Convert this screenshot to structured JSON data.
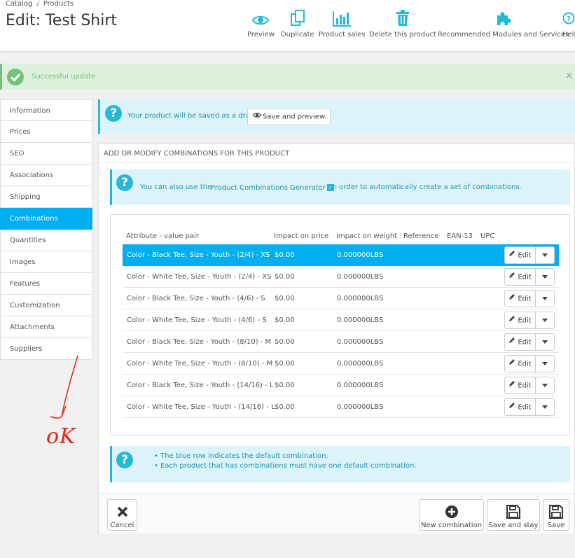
{
  "header": {
    "breadcrumb": [
      "Catalog",
      "Products"
    ],
    "breadcrumb_sep": "/",
    "title": "Edit: Test Shirt",
    "toolbar": {
      "preview": "Preview",
      "duplicate": "Duplicate",
      "product_sales": "Product sales",
      "delete": "Delete this product",
      "recommended": "Recommended Modules and Services",
      "help": "Help"
    }
  },
  "alert_success": {
    "message": "Successful update",
    "close": "×"
  },
  "tabs": [
    "Information",
    "Prices",
    "SEO",
    "Associations",
    "Shipping",
    "Combinations",
    "Quantities",
    "Images",
    "Features",
    "Customization",
    "Attachments",
    "Suppliers"
  ],
  "draft_notice": {
    "text": "Your product will be saved as a draft.",
    "button": "Save and preview"
  },
  "panel": {
    "heading": "ADD OR MODIFY COMBINATIONS FOR THIS PRODUCT",
    "generator_info": {
      "before": "You can also use the",
      "link": "Product Combinations Generator",
      "after": "in order to automatically create a set of combinations."
    },
    "table": {
      "headers": [
        "Attribute - value pair",
        "Impact on price",
        "Impact on weight",
        "Reference",
        "EAN-13",
        "UPC"
      ],
      "edit_label": "Edit",
      "rows": [
        {
          "attr": "Color - Black Tee, Size - Youth - (2/4) - XS",
          "price": "$0.00",
          "weight": "0.000000LBS",
          "default": true
        },
        {
          "attr": "Color - White Tee, Size - Youth - (2/4) - XS",
          "price": "$0.00",
          "weight": "0.000000LBS",
          "default": false
        },
        {
          "attr": "Color - Black Tee, Size - Youth - (4/6) - S",
          "price": "$0.00",
          "weight": "0.000000LBS",
          "default": false
        },
        {
          "attr": "Color - White Tee, Size - Youth - (4/6) - S",
          "price": "$0.00",
          "weight": "0.000000LBS",
          "default": false
        },
        {
          "attr": "Color - Black Tee, Size - Youth - (8/10) - M",
          "price": "$0.00",
          "weight": "0.000000LBS",
          "default": false
        },
        {
          "attr": "Color - White Tee, Size - Youth - (8/10) - M",
          "price": "$0.00",
          "weight": "0.000000LBS",
          "default": false
        },
        {
          "attr": "Color - Black Tee, Size - Youth - (14/16) - L",
          "price": "$0.00",
          "weight": "0.000000LBS",
          "default": false
        },
        {
          "attr": "Color - White Tee, Size - Youth - (14/16) - L",
          "price": "$0.00",
          "weight": "0.000000LBS",
          "default": false
        }
      ]
    },
    "notes": [
      "The blue row indicates the default combination.",
      "Each product that has combinations must have one default combination."
    ],
    "footer": {
      "cancel": "Cancel",
      "new_combination": "New combination",
      "save_and_stay": "Save and stay",
      "save": "Save"
    }
  },
  "annotation": {
    "text": "oK"
  },
  "colors": {
    "accent": "#00aff0",
    "info": "#25b9d7",
    "success": "#72c279",
    "annotation": "#e8221a"
  }
}
